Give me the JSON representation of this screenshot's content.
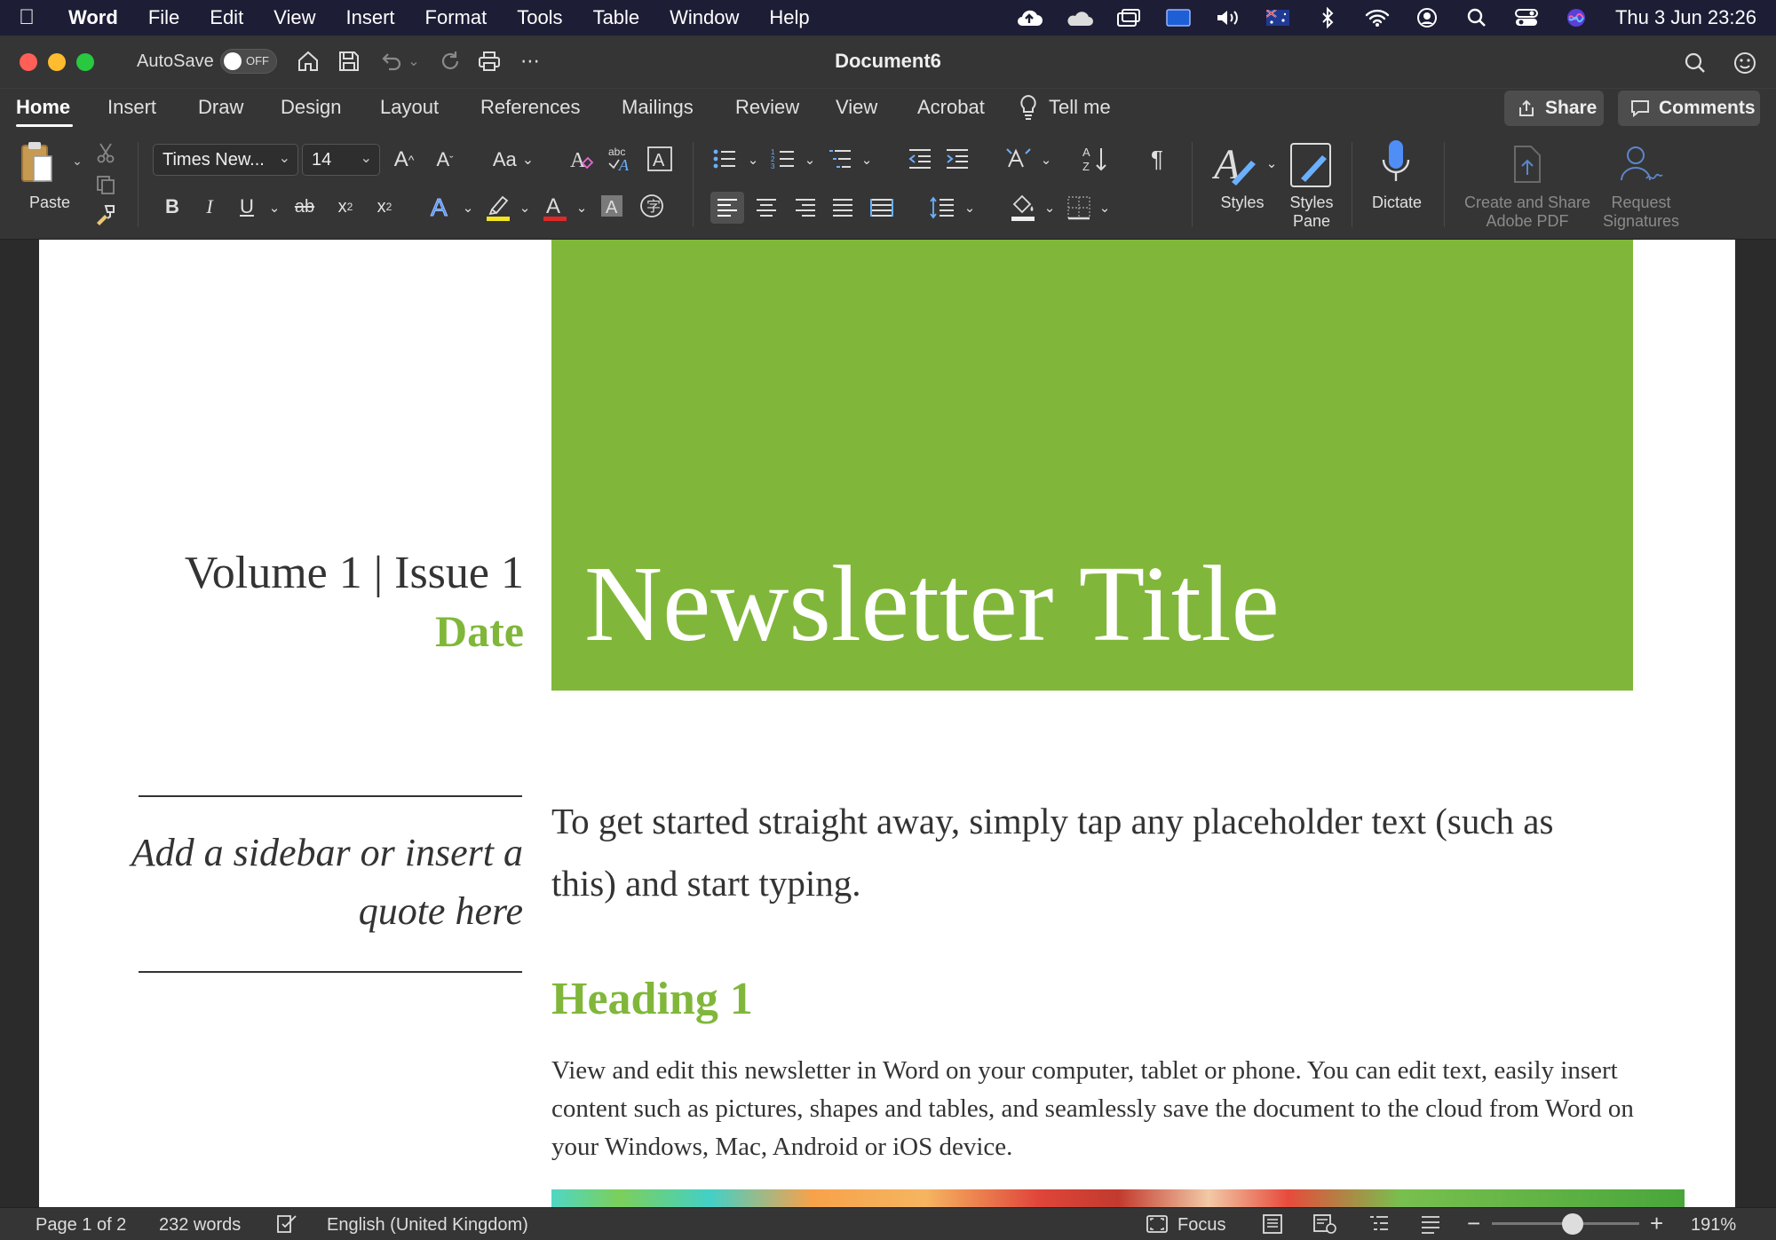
{
  "menubar": {
    "app_name": "Word",
    "items": [
      "File",
      "Edit",
      "View",
      "Insert",
      "Format",
      "Tools",
      "Table",
      "Window",
      "Help"
    ],
    "clock": "Thu 3 Jun  23:26"
  },
  "window": {
    "title": "Document6",
    "autosave_label": "AutoSave",
    "autosave_state": "OFF"
  },
  "tabs": [
    "Home",
    "Insert",
    "Draw",
    "Design",
    "Layout",
    "References",
    "Mailings",
    "Review",
    "View",
    "Acrobat",
    "Tell me"
  ],
  "share_label": "Share",
  "comments_label": "Comments",
  "ribbon": {
    "paste_label": "Paste",
    "font_name": "Times New...",
    "font_size": "14",
    "change_case": "Aa",
    "styles_label": "Styles",
    "styles_pane_label": [
      "Styles",
      "Pane"
    ],
    "dictate_label": "Dictate",
    "adobe_label": [
      "Create and Share",
      "Adobe PDF"
    ],
    "signatures_label": [
      "Request",
      "Signatures"
    ]
  },
  "document": {
    "volume": "Volume 1 | Issue 1",
    "date": "Date",
    "title": "Newsletter Title",
    "quote": "Add a sidebar or insert a quote here",
    "intro": "To get started straight away, simply tap any placeholder text (such as this) and start typing.",
    "heading1": "Heading 1",
    "body": "View and edit this newsletter in Word on your computer, tablet or phone. You can edit text, easily insert content such as pictures, shapes and tables, and seamlessly save the document to the cloud from Word on your Windows, Mac, Android or iOS device.",
    "accent_color": "#80b73a"
  },
  "status": {
    "page": "Page 1 of 2",
    "words": "232 words",
    "language": "English (United Kingdom)",
    "focus": "Focus",
    "zoom": "191%",
    "zoom_level_fraction": 0.55
  }
}
